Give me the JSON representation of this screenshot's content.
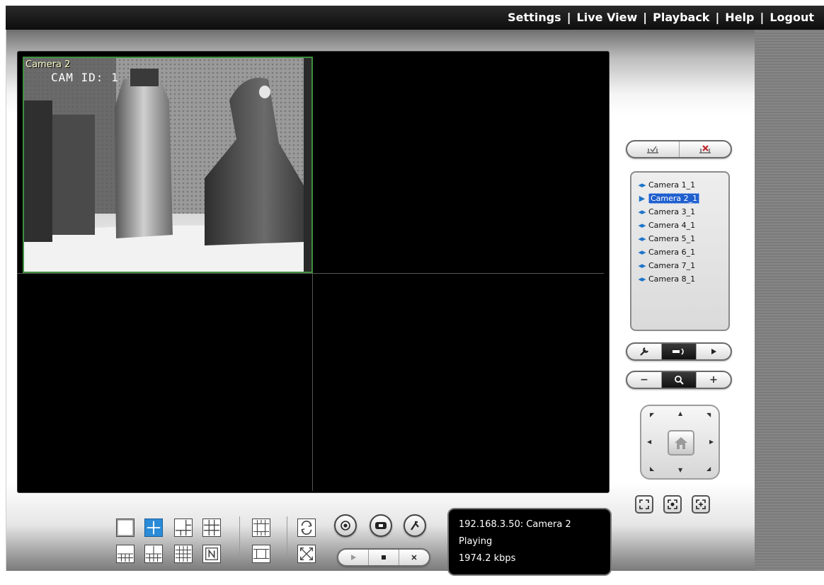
{
  "nav": {
    "settings": "Settings",
    "live_view": "Live View",
    "playback": "Playback",
    "help": "Help",
    "logout": "Logout",
    "separator": "|"
  },
  "video": {
    "active_tile": {
      "title": "Camera 2",
      "osd_text": "CAM ID:  1"
    }
  },
  "camera_list": {
    "items": [
      {
        "label": "Camera 1_1",
        "icon": "camera-icon"
      },
      {
        "label": "Camera 2_1",
        "icon": "play-icon",
        "selected": true
      },
      {
        "label": "Camera 3_1",
        "icon": "camera-icon"
      },
      {
        "label": "Camera 4_1",
        "icon": "camera-icon"
      },
      {
        "label": "Camera 5_1",
        "icon": "camera-icon"
      },
      {
        "label": "Camera 6_1",
        "icon": "camera-icon"
      },
      {
        "label": "Camera 7_1",
        "icon": "camera-icon"
      },
      {
        "label": "Camera 8_1",
        "icon": "camera-icon"
      }
    ]
  },
  "zoom": {
    "minus": "−",
    "plus": "+"
  },
  "status": {
    "source": "192.168.3.50: Camera 2",
    "state": "Playing",
    "bitrate": "1974.2 kbps"
  },
  "colors": {
    "accent": "#2a8bd8",
    "tile_border": "#3f8f3f",
    "selection": "#1f5fce"
  }
}
